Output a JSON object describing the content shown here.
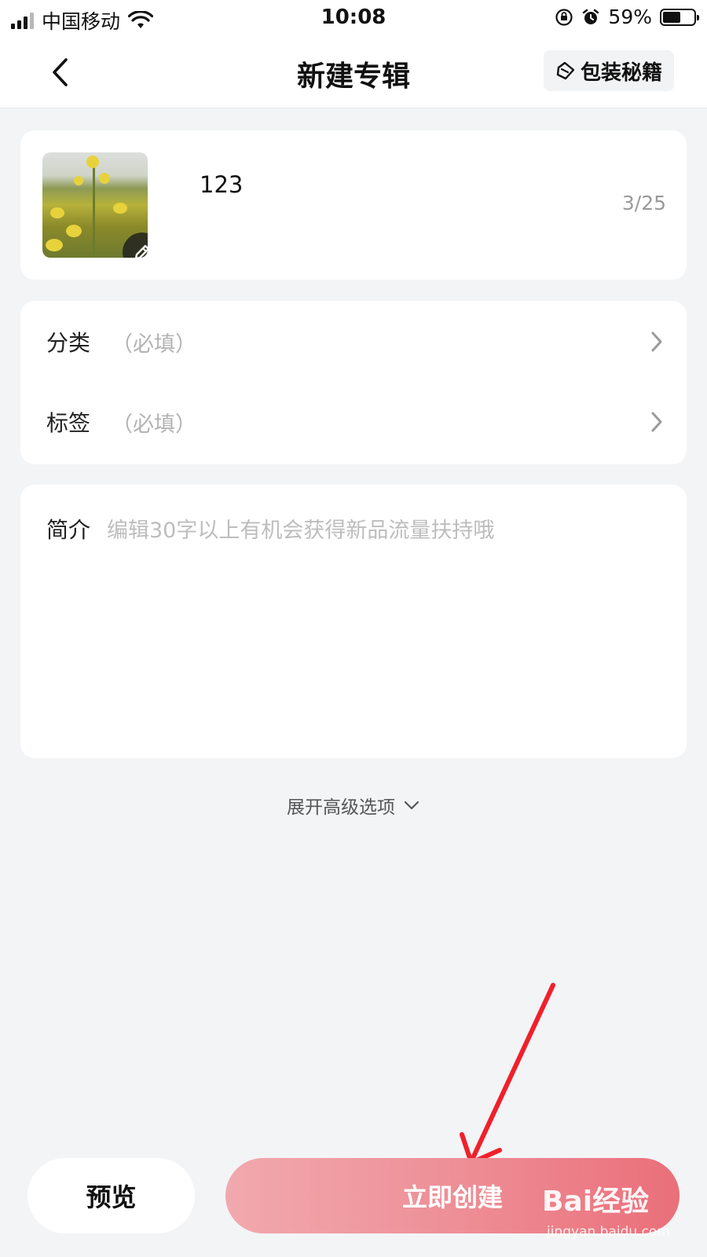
{
  "status_bar": {
    "carrier": "中国移动",
    "time": "10:08",
    "battery": "59%",
    "battery_level": 0.59
  },
  "header": {
    "title": "新建专辑",
    "tips_label": "包装秘籍"
  },
  "cover": {
    "album_name": "123",
    "char_count": "3/25"
  },
  "fields": [
    {
      "label": "分类",
      "hint": "（必填）"
    },
    {
      "label": "标签",
      "hint": "（必填）"
    }
  ],
  "intro": {
    "label": "简介",
    "placeholder": "编辑30字以上有机会获得新品流量扶持哦"
  },
  "advanced_label": "展开高级选项",
  "buttons": {
    "preview": "预览",
    "create": "立即创建"
  },
  "watermark": {
    "logo": "Bai经验",
    "url": "jingyan.baidu.com"
  },
  "colors": {
    "accent": "#ea6f7a",
    "annotation": "#f0202a"
  }
}
